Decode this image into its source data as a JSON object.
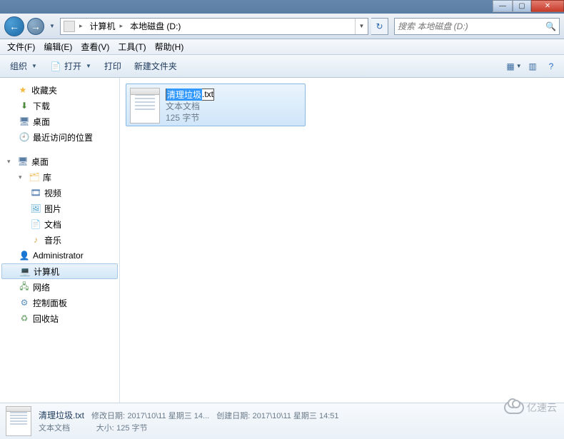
{
  "window": {
    "min": "—",
    "max": "▢",
    "close": "✕"
  },
  "nav": {
    "back": "←",
    "forward": "→",
    "path_root": "计算机",
    "path_current": "本地磁盘 (D:)",
    "refresh": "↻",
    "search_placeholder": "搜索 本地磁盘 (D:)"
  },
  "menu": {
    "file": "文件(F)",
    "edit": "编辑(E)",
    "view": "查看(V)",
    "tools": "工具(T)",
    "help": "帮助(H)"
  },
  "toolbar": {
    "organize": "组织",
    "open": "打开",
    "print": "打印",
    "newfolder": "新建文件夹"
  },
  "sidebar": {
    "favorites": "收藏夹",
    "downloads": "下载",
    "desktop": "桌面",
    "recent": "最近访问的位置",
    "desktop_root": "桌面",
    "libraries": "库",
    "videos": "视频",
    "pictures": "图片",
    "documents": "文档",
    "music": "音乐",
    "admin": "Administrator",
    "computer": "计算机",
    "network": "网络",
    "controlpanel": "控制面板",
    "recyclebin": "回收站"
  },
  "file": {
    "name_selected": "清理垃圾",
    "name_ext": ".txt",
    "type": "文本文档",
    "size": "125 字节"
  },
  "details": {
    "name": "清理垃圾.txt",
    "type": "文本文档",
    "modified_label": "修改日期:",
    "modified_value": "2017\\10\\11 星期三 14...",
    "created_label": "创建日期:",
    "created_value": "2017\\10\\11 星期三 14:51",
    "size_label": "大小:",
    "size_value": "125 字节"
  },
  "watermark": "亿速云"
}
